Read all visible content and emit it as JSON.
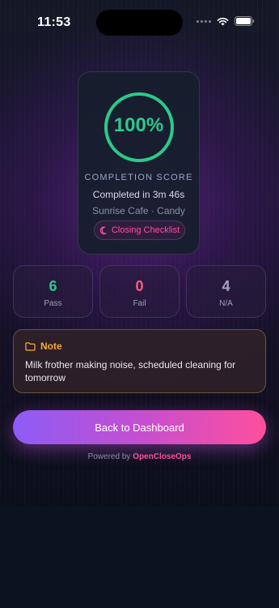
{
  "status_bar": {
    "time": "11:53"
  },
  "score_card": {
    "score_text": "100%",
    "score_fraction": 1.0,
    "label": "COMPLETION SCORE",
    "duration": "Completed in 3m 46s",
    "location": "Sunrise Cafe · Candy",
    "checklist_name": "Closing Checklist",
    "checklist_icon": "moon-icon"
  },
  "stats": [
    {
      "value": "6",
      "label": "Pass",
      "color": "#2cc98a"
    },
    {
      "value": "0",
      "label": "Fail",
      "color": "#ff5c7a"
    },
    {
      "value": "4",
      "label": "N/A",
      "color": "#a6a4c4"
    }
  ],
  "note": {
    "title": "Note",
    "icon": "folder-icon",
    "text": "Milk frother making noise, scheduled cleaning for tomorrow"
  },
  "actions": {
    "back_label": "Back to Dashboard"
  },
  "footer": {
    "powered_prefix": "Powered by",
    "brand": "OpenCloseOps"
  },
  "colors": {
    "accent_green": "#2cc98a",
    "accent_pink": "#ff4f9c",
    "accent_purple": "#8d5cf6",
    "note_accent": "#f2a93a"
  }
}
